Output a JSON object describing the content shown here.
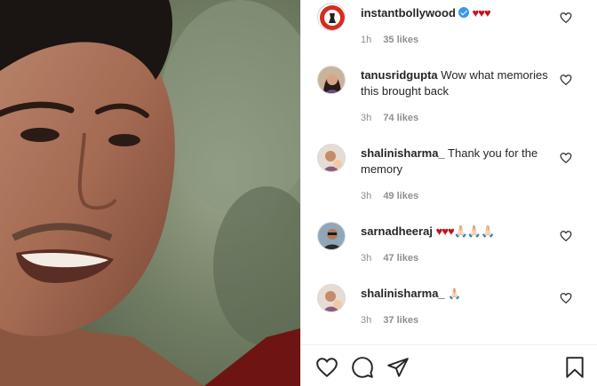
{
  "post": {
    "image_alt": "Close-up of a smiling man",
    "comments": [
      {
        "user": "instantbollywood",
        "verified": true,
        "text": "",
        "emoji": "♥♥♥",
        "time": "1h",
        "likes": "35 likes"
      },
      {
        "user": "tanusridgupta",
        "verified": false,
        "text": "Wow what memories this brought back",
        "emoji": "",
        "time": "3h",
        "likes": "74 likes"
      },
      {
        "user": "shalinisharma_",
        "verified": false,
        "text": "Thank you for the memory",
        "emoji": "",
        "time": "3h",
        "likes": "49 likes"
      },
      {
        "user": "sarnadheeraj",
        "verified": false,
        "text": "",
        "emoji": "♥♥♥🙏🏻🙏🏻🙏🏻",
        "time": "3h",
        "likes": "47 likes"
      },
      {
        "user": "shalinisharma_",
        "verified": false,
        "text": "",
        "emoji": "🙏🏻",
        "time": "3h",
        "likes": "37 likes"
      }
    ]
  },
  "icons": {
    "like": "heart-outline-icon",
    "comment": "speech-bubble-icon",
    "share": "paper-plane-icon",
    "save": "bookmark-icon"
  },
  "colors": {
    "heart": "#c0141e",
    "verified": "#3897f0",
    "meta": "#8e8e8e"
  }
}
